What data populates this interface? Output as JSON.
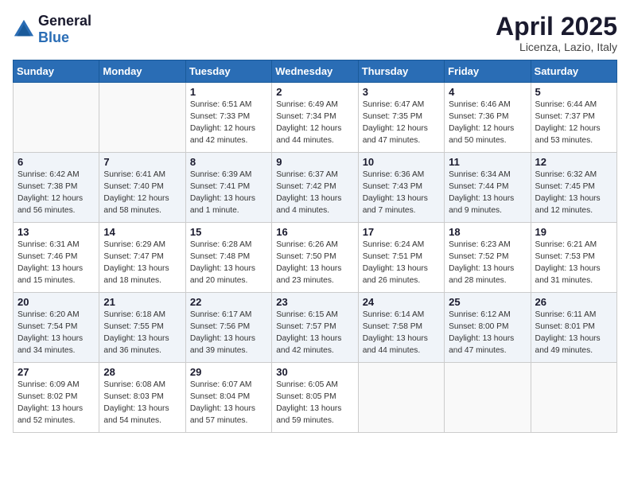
{
  "logo": {
    "general": "General",
    "blue": "Blue"
  },
  "title": "April 2025",
  "location": "Licenza, Lazio, Italy",
  "days_of_week": [
    "Sunday",
    "Monday",
    "Tuesday",
    "Wednesday",
    "Thursday",
    "Friday",
    "Saturday"
  ],
  "weeks": [
    [
      {
        "day": "",
        "sunrise": "",
        "sunset": "",
        "daylight": ""
      },
      {
        "day": "",
        "sunrise": "",
        "sunset": "",
        "daylight": ""
      },
      {
        "day": "1",
        "sunrise": "Sunrise: 6:51 AM",
        "sunset": "Sunset: 7:33 PM",
        "daylight": "Daylight: 12 hours and 42 minutes."
      },
      {
        "day": "2",
        "sunrise": "Sunrise: 6:49 AM",
        "sunset": "Sunset: 7:34 PM",
        "daylight": "Daylight: 12 hours and 44 minutes."
      },
      {
        "day": "3",
        "sunrise": "Sunrise: 6:47 AM",
        "sunset": "Sunset: 7:35 PM",
        "daylight": "Daylight: 12 hours and 47 minutes."
      },
      {
        "day": "4",
        "sunrise": "Sunrise: 6:46 AM",
        "sunset": "Sunset: 7:36 PM",
        "daylight": "Daylight: 12 hours and 50 minutes."
      },
      {
        "day": "5",
        "sunrise": "Sunrise: 6:44 AM",
        "sunset": "Sunset: 7:37 PM",
        "daylight": "Daylight: 12 hours and 53 minutes."
      }
    ],
    [
      {
        "day": "6",
        "sunrise": "Sunrise: 6:42 AM",
        "sunset": "Sunset: 7:38 PM",
        "daylight": "Daylight: 12 hours and 56 minutes."
      },
      {
        "day": "7",
        "sunrise": "Sunrise: 6:41 AM",
        "sunset": "Sunset: 7:40 PM",
        "daylight": "Daylight: 12 hours and 58 minutes."
      },
      {
        "day": "8",
        "sunrise": "Sunrise: 6:39 AM",
        "sunset": "Sunset: 7:41 PM",
        "daylight": "Daylight: 13 hours and 1 minute."
      },
      {
        "day": "9",
        "sunrise": "Sunrise: 6:37 AM",
        "sunset": "Sunset: 7:42 PM",
        "daylight": "Daylight: 13 hours and 4 minutes."
      },
      {
        "day": "10",
        "sunrise": "Sunrise: 6:36 AM",
        "sunset": "Sunset: 7:43 PM",
        "daylight": "Daylight: 13 hours and 7 minutes."
      },
      {
        "day": "11",
        "sunrise": "Sunrise: 6:34 AM",
        "sunset": "Sunset: 7:44 PM",
        "daylight": "Daylight: 13 hours and 9 minutes."
      },
      {
        "day": "12",
        "sunrise": "Sunrise: 6:32 AM",
        "sunset": "Sunset: 7:45 PM",
        "daylight": "Daylight: 13 hours and 12 minutes."
      }
    ],
    [
      {
        "day": "13",
        "sunrise": "Sunrise: 6:31 AM",
        "sunset": "Sunset: 7:46 PM",
        "daylight": "Daylight: 13 hours and 15 minutes."
      },
      {
        "day": "14",
        "sunrise": "Sunrise: 6:29 AM",
        "sunset": "Sunset: 7:47 PM",
        "daylight": "Daylight: 13 hours and 18 minutes."
      },
      {
        "day": "15",
        "sunrise": "Sunrise: 6:28 AM",
        "sunset": "Sunset: 7:48 PM",
        "daylight": "Daylight: 13 hours and 20 minutes."
      },
      {
        "day": "16",
        "sunrise": "Sunrise: 6:26 AM",
        "sunset": "Sunset: 7:50 PM",
        "daylight": "Daylight: 13 hours and 23 minutes."
      },
      {
        "day": "17",
        "sunrise": "Sunrise: 6:24 AM",
        "sunset": "Sunset: 7:51 PM",
        "daylight": "Daylight: 13 hours and 26 minutes."
      },
      {
        "day": "18",
        "sunrise": "Sunrise: 6:23 AM",
        "sunset": "Sunset: 7:52 PM",
        "daylight": "Daylight: 13 hours and 28 minutes."
      },
      {
        "day": "19",
        "sunrise": "Sunrise: 6:21 AM",
        "sunset": "Sunset: 7:53 PM",
        "daylight": "Daylight: 13 hours and 31 minutes."
      }
    ],
    [
      {
        "day": "20",
        "sunrise": "Sunrise: 6:20 AM",
        "sunset": "Sunset: 7:54 PM",
        "daylight": "Daylight: 13 hours and 34 minutes."
      },
      {
        "day": "21",
        "sunrise": "Sunrise: 6:18 AM",
        "sunset": "Sunset: 7:55 PM",
        "daylight": "Daylight: 13 hours and 36 minutes."
      },
      {
        "day": "22",
        "sunrise": "Sunrise: 6:17 AM",
        "sunset": "Sunset: 7:56 PM",
        "daylight": "Daylight: 13 hours and 39 minutes."
      },
      {
        "day": "23",
        "sunrise": "Sunrise: 6:15 AM",
        "sunset": "Sunset: 7:57 PM",
        "daylight": "Daylight: 13 hours and 42 minutes."
      },
      {
        "day": "24",
        "sunrise": "Sunrise: 6:14 AM",
        "sunset": "Sunset: 7:58 PM",
        "daylight": "Daylight: 13 hours and 44 minutes."
      },
      {
        "day": "25",
        "sunrise": "Sunrise: 6:12 AM",
        "sunset": "Sunset: 8:00 PM",
        "daylight": "Daylight: 13 hours and 47 minutes."
      },
      {
        "day": "26",
        "sunrise": "Sunrise: 6:11 AM",
        "sunset": "Sunset: 8:01 PM",
        "daylight": "Daylight: 13 hours and 49 minutes."
      }
    ],
    [
      {
        "day": "27",
        "sunrise": "Sunrise: 6:09 AM",
        "sunset": "Sunset: 8:02 PM",
        "daylight": "Daylight: 13 hours and 52 minutes."
      },
      {
        "day": "28",
        "sunrise": "Sunrise: 6:08 AM",
        "sunset": "Sunset: 8:03 PM",
        "daylight": "Daylight: 13 hours and 54 minutes."
      },
      {
        "day": "29",
        "sunrise": "Sunrise: 6:07 AM",
        "sunset": "Sunset: 8:04 PM",
        "daylight": "Daylight: 13 hours and 57 minutes."
      },
      {
        "day": "30",
        "sunrise": "Sunrise: 6:05 AM",
        "sunset": "Sunset: 8:05 PM",
        "daylight": "Daylight: 13 hours and 59 minutes."
      },
      {
        "day": "",
        "sunrise": "",
        "sunset": "",
        "daylight": ""
      },
      {
        "day": "",
        "sunrise": "",
        "sunset": "",
        "daylight": ""
      },
      {
        "day": "",
        "sunrise": "",
        "sunset": "",
        "daylight": ""
      }
    ]
  ]
}
